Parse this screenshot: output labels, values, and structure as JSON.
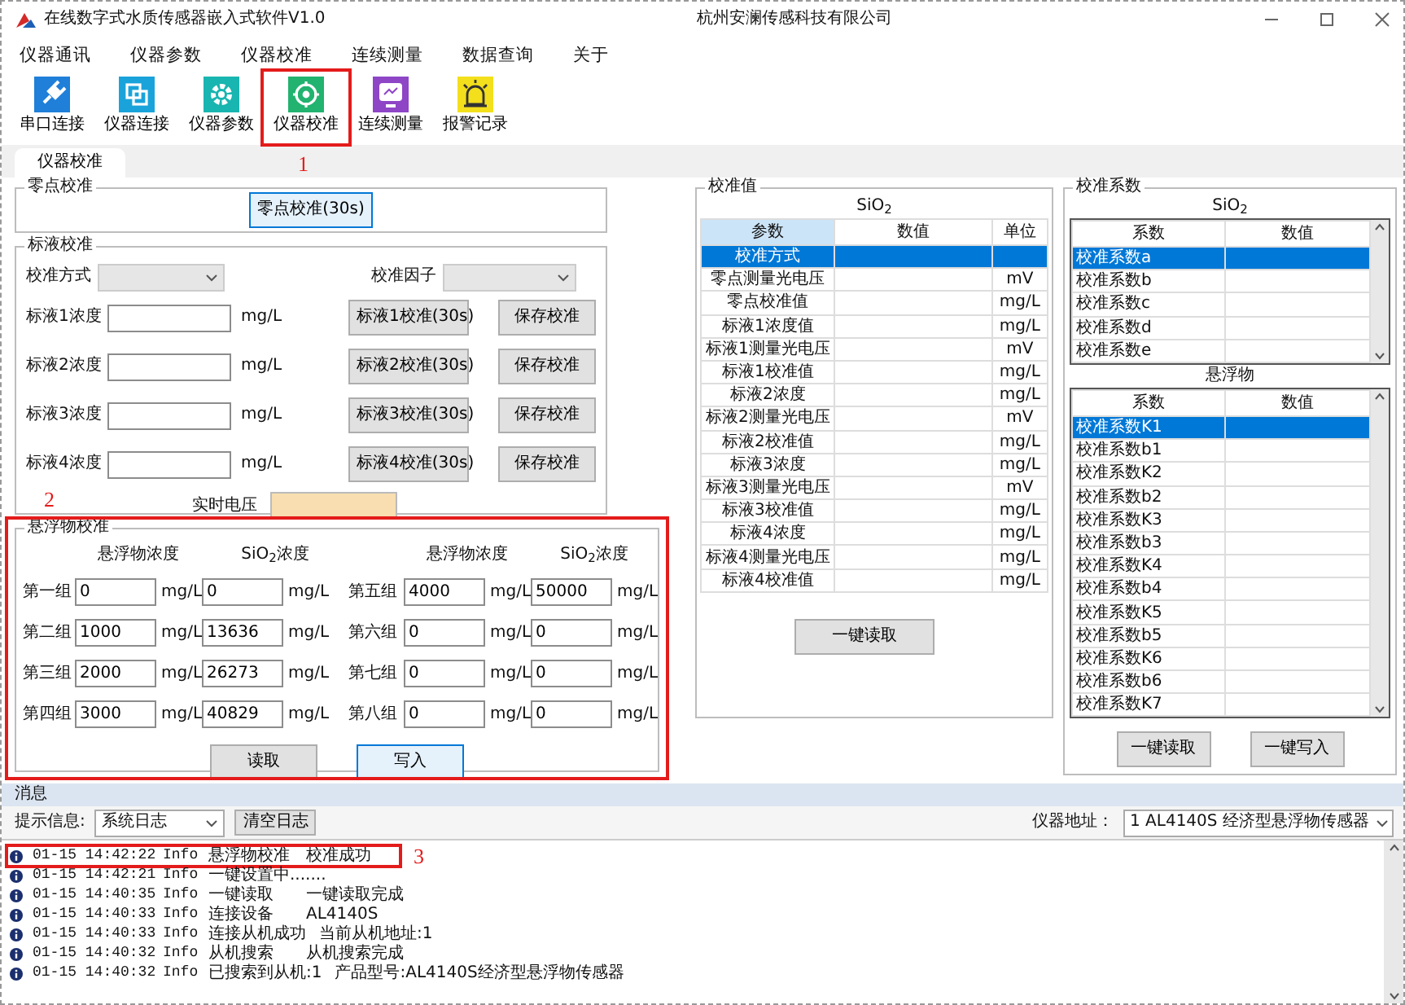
{
  "window": {
    "title": "在线数字式水质传感器嵌入式软件V1.0",
    "company": "杭州安澜传感科技有限公司"
  },
  "menu": [
    "仪器通讯",
    "仪器参数",
    "仪器校准",
    "连续测量",
    "数据查询",
    "关于"
  ],
  "toolbar": [
    {
      "label": "串口连接",
      "kind": "plug",
      "color": "#1f7fd9"
    },
    {
      "label": "仪器连接",
      "kind": "link",
      "color": "#1aa3da"
    },
    {
      "label": "仪器参数",
      "kind": "gear",
      "color": "#19b5b0"
    },
    {
      "label": "仪器校准",
      "kind": "target",
      "color": "#21b36f",
      "highlight_label": "1"
    },
    {
      "label": "连续测量",
      "kind": "monitor",
      "color": "#8e45c6"
    },
    {
      "label": "报警记录",
      "kind": "alarm",
      "color": "#f3df1c"
    }
  ],
  "tabs": [
    {
      "label": "仪器校准",
      "selected": true
    }
  ],
  "zero_cal": {
    "title": "零点校准",
    "button": "零点校准(30s)"
  },
  "std_cal": {
    "title": "标液校准",
    "method_label": "校准方式",
    "factor_label": "校准因子",
    "voltage_label": "实时电压",
    "rows": [
      {
        "label": "标液1浓度",
        "unit": "mg/L",
        "cal_button": "标液1校准(30s)",
        "save_button": "保存校准"
      },
      {
        "label": "标液2浓度",
        "unit": "mg/L",
        "cal_button": "标液2校准(30s)",
        "save_button": "保存校准"
      },
      {
        "label": "标液3浓度",
        "unit": "mg/L",
        "cal_button": "标液3校准(30s)",
        "save_button": "保存校准"
      },
      {
        "label": "标液4浓度",
        "unit": "mg/L",
        "cal_button": "标液4校准(30s)",
        "save_button": "保存校准"
      }
    ]
  },
  "ss_cal": {
    "title": "悬浮物校准",
    "highlight_label": "2",
    "col_headers": [
      "悬浮物浓度",
      "SiO$_{2}$浓度",
      "悬浮物浓度",
      "SiO$_{2}$浓度"
    ],
    "groups": [
      {
        "label": "第一组",
        "ss": "0",
        "ss_unit": "mg/L",
        "sio2": "0",
        "sio2_unit": "mg/L"
      },
      {
        "label": "第二组",
        "ss": "1000",
        "ss_unit": "mg/L",
        "sio2": "13636",
        "sio2_unit": "mg/L"
      },
      {
        "label": "第三组",
        "ss": "2000",
        "ss_unit": "mg/L",
        "sio2": "26273",
        "sio2_unit": "mg/L"
      },
      {
        "label": "第四组",
        "ss": "3000",
        "ss_unit": "mg/L",
        "sio2": "40829",
        "sio2_unit": "mg/L"
      },
      {
        "label": "第五组",
        "ss": "4000",
        "ss_unit": "mg/L",
        "sio2": "50000",
        "sio2_unit": "mg/L"
      },
      {
        "label": "第六组",
        "ss": "0",
        "ss_unit": "mg/L",
        "sio2": "0",
        "sio2_unit": "mg/L"
      },
      {
        "label": "第七组",
        "ss": "0",
        "ss_unit": "mg/L",
        "sio2": "0",
        "sio2_unit": "mg/L"
      },
      {
        "label": "第八组",
        "ss": "0",
        "ss_unit": "mg/L",
        "sio2": "0",
        "sio2_unit": "mg/L"
      }
    ],
    "buttons": [
      {
        "label": "读取",
        "focused": false
      },
      {
        "label": "写入",
        "focused": true
      }
    ]
  },
  "cal_values": {
    "title": "校准值",
    "subtitle": "SiO$_{2}$",
    "columns": [
      {
        "label": "参数",
        "selected": true
      },
      {
        "label": "数值",
        "selected": false
      },
      {
        "label": "单位",
        "selected": false
      }
    ],
    "rows": [
      {
        "param": "校准方式",
        "selected": true
      },
      {
        "param": "零点测量光电压",
        "unit": "mV",
        "selected": false
      },
      {
        "param": "零点校准值",
        "unit": "mg/L",
        "selected": false
      },
      {
        "param": "标液1浓度值",
        "unit": "mg/L",
        "selected": false
      },
      {
        "param": "标液1测量光电压",
        "unit": "mV",
        "selected": false
      },
      {
        "param": "标液1校准值",
        "unit": "mg/L",
        "selected": false
      },
      {
        "param": "标液2浓度",
        "unit": "mg/L",
        "selected": false
      },
      {
        "param": "标液2测量光电压",
        "unit": "mV",
        "selected": false
      },
      {
        "param": "标液2校准值",
        "unit": "mg/L",
        "selected": false
      },
      {
        "param": "标液3浓度",
        "unit": "mg/L",
        "selected": false
      },
      {
        "param": "标液3测量光电压",
        "unit": "mV",
        "selected": false
      },
      {
        "param": "标液3校准值",
        "unit": "mg/L",
        "selected": false
      },
      {
        "param": "标液4浓度",
        "unit": "mg/L",
        "selected": false
      },
      {
        "param": "标液4测量光电压",
        "unit": "mg/L",
        "selected": false
      },
      {
        "param": "标液4校准值",
        "unit": "mg/L",
        "selected": false
      }
    ],
    "button": "一键读取"
  },
  "coefficients": {
    "title": "校准系数",
    "tables": [
      {
        "subtitle": "SiO$_{2}$",
        "columns": [
          "系数",
          "数值"
        ],
        "rows": [
          {
            "name": "校准系数a",
            "selected": true
          },
          {
            "name": "校准系数b",
            "selected": false
          },
          {
            "name": "校准系数c",
            "selected": false
          },
          {
            "name": "校准系数d",
            "selected": false
          },
          {
            "name": "校准系数e",
            "selected": false
          }
        ]
      },
      {
        "subtitle": "悬浮物",
        "columns": [
          "系数",
          "数值"
        ],
        "rows": [
          {
            "name": "校准系数K1",
            "selected": true
          },
          {
            "name": "校准系数b1",
            "selected": false
          },
          {
            "name": "校准系数K2",
            "selected": false
          },
          {
            "name": "校准系数b2",
            "selected": false
          },
          {
            "name": "校准系数K3",
            "selected": false
          },
          {
            "name": "校准系数b3",
            "selected": false
          },
          {
            "name": "校准系数K4",
            "selected": false
          },
          {
            "name": "校准系数b4",
            "selected": false
          },
          {
            "name": "校准系数K5",
            "selected": false
          },
          {
            "name": "校准系数b5",
            "selected": false
          },
          {
            "name": "校准系数K6",
            "selected": false
          },
          {
            "name": "校准系数b6",
            "selected": false
          },
          {
            "name": "校准系数K7",
            "selected": false
          }
        ]
      }
    ],
    "buttons": [
      "一键读取",
      "一键写入"
    ]
  },
  "message_header": "消息",
  "log_toolbar": {
    "label": "提示信息:",
    "select": "系统日志",
    "clear_button": "清空日志",
    "address_label": "仪器地址：",
    "address_select": "1  AL4140S 经济型悬浮物传感器"
  },
  "log": [
    {
      "time": "01-15 14:42:22",
      "level": "Info",
      "source": "悬浮物校准",
      "message": "校准成功",
      "highlight_label": "3"
    },
    {
      "time": "01-15 14:42:21",
      "level": "Info",
      "source": "一键设置中......."
    },
    {
      "time": "01-15 14:40:35",
      "level": "Info",
      "source": "一键读取",
      "message": "一键读取完成"
    },
    {
      "time": "01-15 14:40:33",
      "level": "Info",
      "source": "连接设备",
      "message": "AL4140S"
    },
    {
      "time": "01-15 14:40:33",
      "level": "Info",
      "source": "连接从机成功",
      "message": "当前从机地址:1"
    },
    {
      "time": "01-15 14:40:32",
      "level": "Info",
      "source": "从机搜索",
      "message": "从机搜索完成"
    },
    {
      "time": "01-15 14:40:32",
      "level": "Info",
      "source": "已搜索到从机:1",
      "message": "产品型号:AL4140S经济型悬浮物传感器"
    }
  ]
}
